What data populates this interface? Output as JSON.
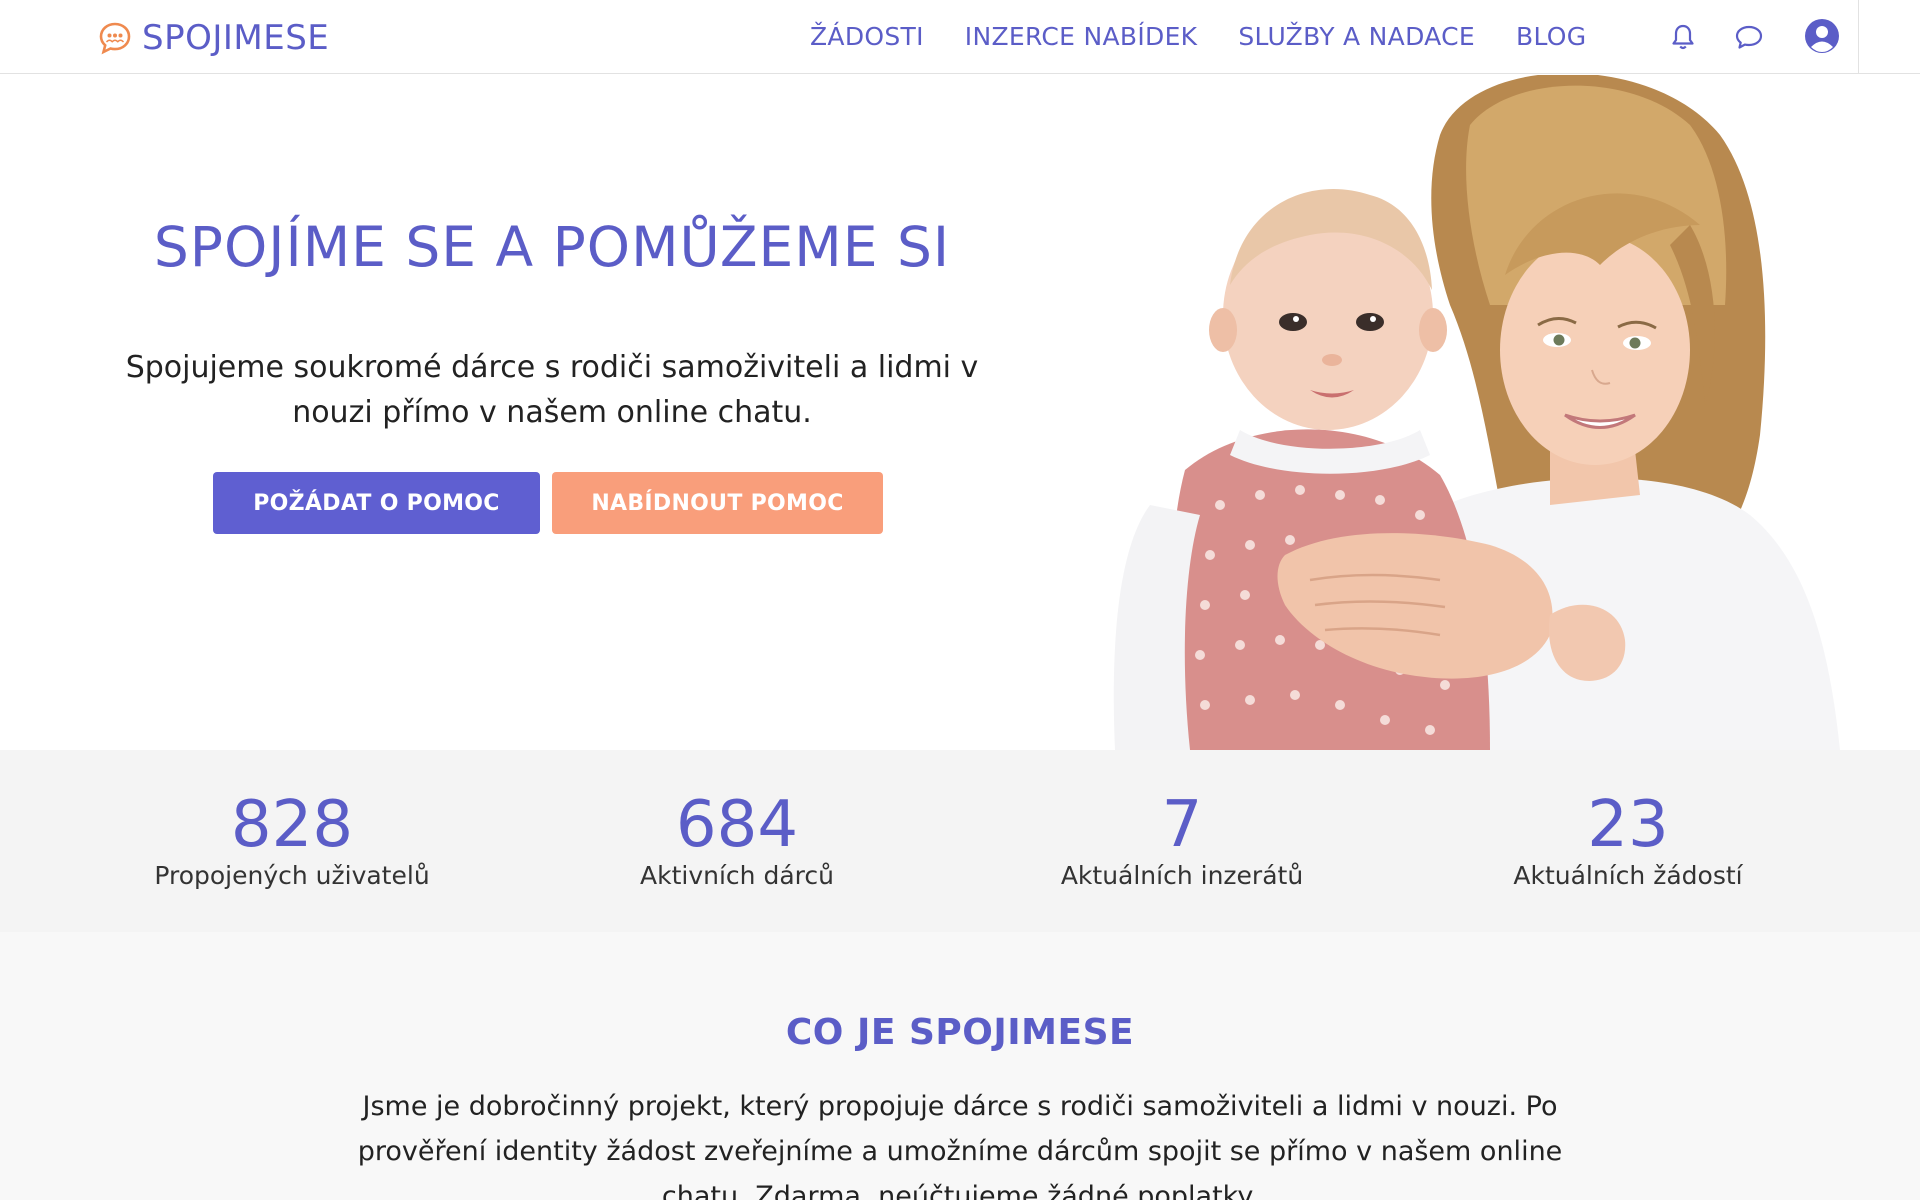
{
  "header": {
    "logo_text": "SPOJIMESE",
    "nav": [
      {
        "label": "ŽÁDOSTI"
      },
      {
        "label": "INZERCE NABÍDEK"
      },
      {
        "label": "SLUŽBY A NADACE"
      },
      {
        "label": "BLOG"
      }
    ],
    "icons": [
      "bell-icon",
      "chat-icon",
      "account-icon"
    ]
  },
  "hero": {
    "title": "SPOJÍME SE A POMŮŽEME SI",
    "subtitle": "Spojujeme soukromé dárce s rodiči samoživiteli a lidmi v nouzi přímo v našem online chatu.",
    "primary_button": "POŽÁDAT O POMOC",
    "secondary_button": "NABÍDNOUT POMOC"
  },
  "stats": [
    {
      "value": "828",
      "label": "Propojených uživatelů"
    },
    {
      "value": "684",
      "label": "Aktivních dárců"
    },
    {
      "value": "7",
      "label": "Aktuálních inzerátů"
    },
    {
      "value": "23",
      "label": "Aktuálních žádostí"
    }
  ],
  "about": {
    "title": "CO JE SPOJIMESE",
    "text": "Jsme je dobročinný projekt, který propojuje dárce s rodiči samoživiteli a lidmi v nouzi. Po prověření identity žádost zveřejníme a umožníme dárcům spojit se přímo v našem online chatu. Zdarma, neúčtujeme žádné poplatky."
  },
  "colors": {
    "brand": "#5b5dc7",
    "primary_button": "#5f5fd1",
    "secondary_button": "#f99e7b",
    "logo_accent": "#ef8a4f"
  }
}
